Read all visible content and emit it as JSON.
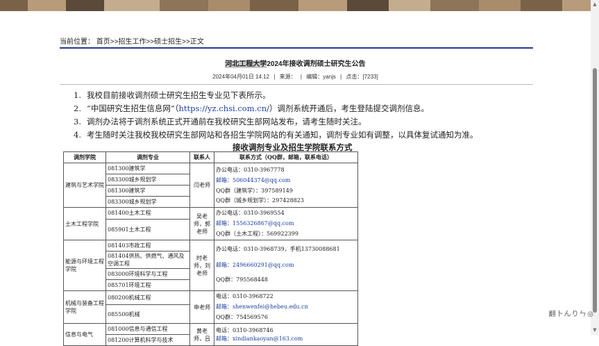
{
  "breadcrumb": {
    "prefix": "当前位置：",
    "items": [
      "首页",
      ">>",
      "招生工作",
      ">>",
      "硕士招生",
      ">>",
      "正文"
    ]
  },
  "article": {
    "title_highlight": "河北工程大学",
    "title_rest": "2024年接收调剂硕士研究生公告",
    "date": "2024年04月01日 14:12",
    "sep1": "|",
    "source": "来源：",
    "sep2": "|",
    "editor": "编辑：yanjs",
    "sep3": "|",
    "clicks": "点击：[7233]"
  },
  "items": [
    {
      "num": "1.",
      "text": "我校目前接收调剂硕士研究生招生专业见下表所示。"
    },
    {
      "num": "2.",
      "text_a": "“中国研究生招生信息网”（",
      "link": "https://yz.chsi.com.cn/",
      "text_b": "）调剂系统开通后，考生登陆提交调剂信息。"
    },
    {
      "num": "3.",
      "text": "调剂办法将于调剂系统正式开通前在我校研究生部网站发布，请考生随时关注。"
    },
    {
      "num": "4.",
      "text": "考生随时关注我校我校研究生部网站和各招生学院网站的有关通知，调剂专业如有调整，以具体复试通知为准。"
    }
  ],
  "table": {
    "title": "接收调剂专业及招生学院联系方式",
    "headers": [
      "调剂学院",
      "调剂专业",
      "联系人",
      "联系方式（QQ群，邮箱，联系电话）"
    ],
    "groups": [
      {
        "dept": "建筑与艺术学院",
        "contact": "闫老师",
        "majors": [
          "081300建筑学",
          "083300城乡规划学",
          "081300建筑学",
          "083300城乡规划学"
        ],
        "info": [
          {
            "t": "办公电话：0310-3967778",
            "link": false
          },
          {
            "t": "邮箱：506044374@qq.com",
            "link": true
          },
          {
            "t": "QQ群（建筑学）：397589149",
            "link": false
          },
          {
            "t": "QQ群（城乡规划学）：297428823",
            "link": false
          }
        ]
      },
      {
        "dept": "土木工程学院",
        "contact": "吴老师，郭老师",
        "majors": [
          "081400土木工程",
          "085901土木工程"
        ],
        "info": [
          {
            "t": "办公电话：0310-3969554",
            "link": false
          },
          {
            "t": "邮箱：1556326867@qq.com",
            "link": true
          },
          {
            "t": "QQ群（土木工程）：569922399",
            "link": false
          }
        ]
      },
      {
        "dept": "能源与环境工程学院",
        "contact": "时老师，刘老师",
        "majors": [
          "081403市政工程",
          "081404供热、供燃气、通风及空调工程",
          "083000环境科学与工程",
          "085701环境工程"
        ],
        "info": [
          {
            "t": "办公电话：0310-3968739，手机13730088681",
            "link": false
          },
          {
            "t": "邮箱：2496660291@qq.com",
            "link": true
          },
          {
            "t": "QQ群：795568448",
            "link": false
          }
        ]
      },
      {
        "dept": "机械与装备工程学院",
        "contact": "申老师",
        "majors": [
          "080200机械工程",
          "085500机械"
        ],
        "info": [
          {
            "t": "电话：0310-3968722",
            "link": false
          },
          {
            "t": "邮箱：shenwenfei@hebeu.edu.cn",
            "link": true
          },
          {
            "t": "QQ群：754569576",
            "link": false
          }
        ]
      },
      {
        "dept": "信息与电气",
        "contact": "黄老师，吕",
        "majors": [
          "081000信息与通信工程",
          "081200计算机科学与技术"
        ],
        "info": [
          {
            "t": "电话：0310-3968746",
            "link": false
          },
          {
            "t": "邮箱：xindiankaoyan@163.com",
            "link": true
          }
        ]
      }
    ]
  },
  "toolbar": {
    "icons": [
      "翻",
      "卜",
      "ん",
      "り",
      "ㄣ",
      "◎"
    ]
  }
}
